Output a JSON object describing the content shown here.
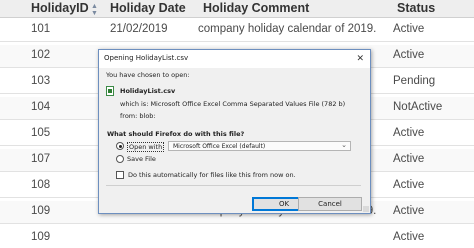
{
  "table": {
    "headers": {
      "id": "HolidayID",
      "date": "Holiday Date",
      "comment": "Holiday Comment",
      "status": "Status"
    },
    "rows": [
      {
        "id": "101",
        "date": "21/02/2019",
        "comment": "company holiday calendar of 2019.",
        "status": "Active"
      },
      {
        "id": "102",
        "date": "",
        "comment": "",
        "status": "Active"
      },
      {
        "id": "103",
        "date": "",
        "comment": "",
        "status": "Pending"
      },
      {
        "id": "104",
        "date": "",
        "comment": "",
        "status": "NotActive"
      },
      {
        "id": "105",
        "date": "",
        "comment": "",
        "status": "Active"
      },
      {
        "id": "107",
        "date": "",
        "comment": "",
        "status": "Active"
      },
      {
        "id": "108",
        "date": "",
        "comment": "",
        "status": "Active"
      },
      {
        "id": "109",
        "date": "21/02/2019",
        "comment": "company holiday calendar of 2019.",
        "status": "Active"
      },
      {
        "id": "109",
        "date": "",
        "comment": "",
        "status": "Active"
      }
    ]
  },
  "dialog": {
    "title": "Opening HolidayList.csv",
    "chosen_text": "You have chosen to open:",
    "file_name": "HolidayList.csv",
    "which_is": "which is: Microsoft Office Excel Comma Separated Values File (782 b)",
    "from": "from: blob:",
    "question": "What should Firefox do with this file?",
    "open_with_label": "Open with",
    "open_with_value": "Microsoft Office Excel (default)",
    "save_file_label": "Save File",
    "auto_label": "Do this automatically for files like this from now on.",
    "ok_label": "OK",
    "cancel_label": "Cancel",
    "selected_option": "open_with",
    "auto_checked": false
  }
}
